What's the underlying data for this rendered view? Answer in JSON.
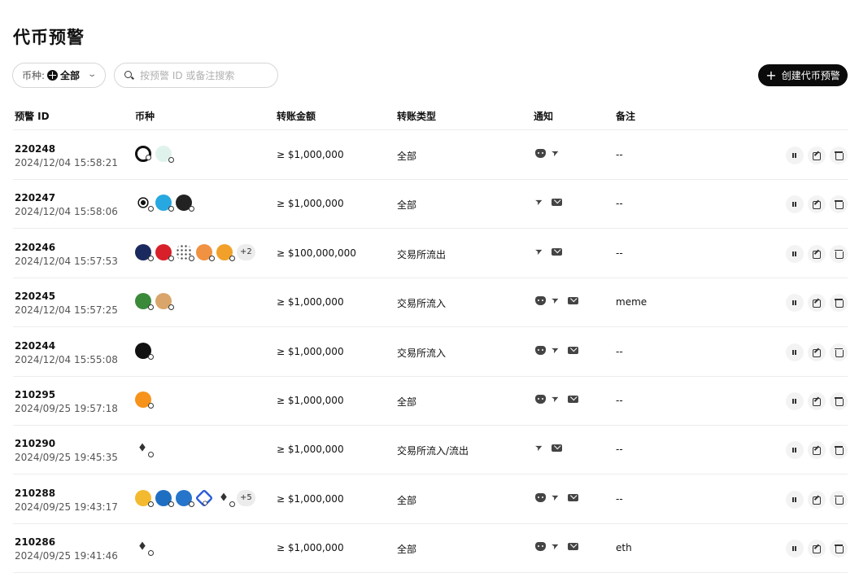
{
  "page": {
    "title": "代币预警"
  },
  "filters": {
    "coin_label": "币种:",
    "coin_value": "全部",
    "search_placeholder": "按预警 ID 或备注搜索",
    "create_label": "创建代币预警"
  },
  "table": {
    "headers": [
      "预警 ID",
      "币种",
      "转账金额",
      "转账类型",
      "通知",
      "备注"
    ],
    "rows": [
      {
        "id": "220248",
        "time": "2024/12/04 15:58:21",
        "coins": [
          "ring-coin",
          "light-coin"
        ],
        "more": "",
        "amount": "≥ $1,000,000",
        "type": "全部",
        "notify": [
          "discord",
          "telegram"
        ],
        "note": "--"
      },
      {
        "id": "220247",
        "time": "2024/12/04 15:58:06",
        "coins": [
          "burst-coin",
          "blue-coin",
          "wink-coin"
        ],
        "more": "",
        "amount": "≥ $1,000,000",
        "type": "全部",
        "notify": [
          "telegram",
          "mail"
        ],
        "note": "--"
      },
      {
        "id": "220246",
        "time": "2024/12/04 15:57:53",
        "coins": [
          "navy-coin",
          "red-coin",
          "dots-coin",
          "orange-coin",
          "amber-coin"
        ],
        "more": "+2",
        "amount": "≥ $100,000,000",
        "type": "交易所流出",
        "notify": [
          "telegram",
          "mail"
        ],
        "note": "--"
      },
      {
        "id": "220245",
        "time": "2024/12/04 15:57:25",
        "coins": [
          "pepe-coin",
          "dog-coin"
        ],
        "more": "",
        "amount": "≥ $1,000,000",
        "type": "交易所流入",
        "notify": [
          "discord",
          "telegram",
          "mail"
        ],
        "note": "meme"
      },
      {
        "id": "220244",
        "time": "2024/12/04 15:55:08",
        "coins": [
          "okb-coin"
        ],
        "more": "",
        "amount": "≥ $1,000,000",
        "type": "交易所流入",
        "notify": [
          "discord",
          "telegram",
          "mail"
        ],
        "note": "--"
      },
      {
        "id": "210295",
        "time": "2024/09/25 19:57:18",
        "coins": [
          "btc-coin"
        ],
        "more": "",
        "amount": "≥ $1,000,000",
        "type": "全部",
        "notify": [
          "discord",
          "telegram",
          "mail"
        ],
        "note": "--"
      },
      {
        "id": "210290",
        "time": "2024/09/25 19:45:35",
        "coins": [
          "eth-coin"
        ],
        "more": "",
        "amount": "≥ $1,000,000",
        "type": "交易所流入/流出",
        "notify": [
          "telegram",
          "mail"
        ],
        "note": "--"
      },
      {
        "id": "210288",
        "time": "2024/09/25 19:43:17",
        "coins": [
          "bnb-coin",
          "ton-coin",
          "usdc-coin",
          "link-coin",
          "eth-coin"
        ],
        "more": "+5",
        "amount": "≥ $1,000,000",
        "type": "全部",
        "notify": [
          "discord",
          "telegram",
          "mail"
        ],
        "note": "--"
      },
      {
        "id": "210286",
        "time": "2024/09/25 19:41:46",
        "coins": [
          "eth-coin"
        ],
        "more": "",
        "amount": "≥ $1,000,000",
        "type": "全部",
        "notify": [
          "discord",
          "telegram",
          "mail"
        ],
        "note": "eth"
      }
    ]
  }
}
